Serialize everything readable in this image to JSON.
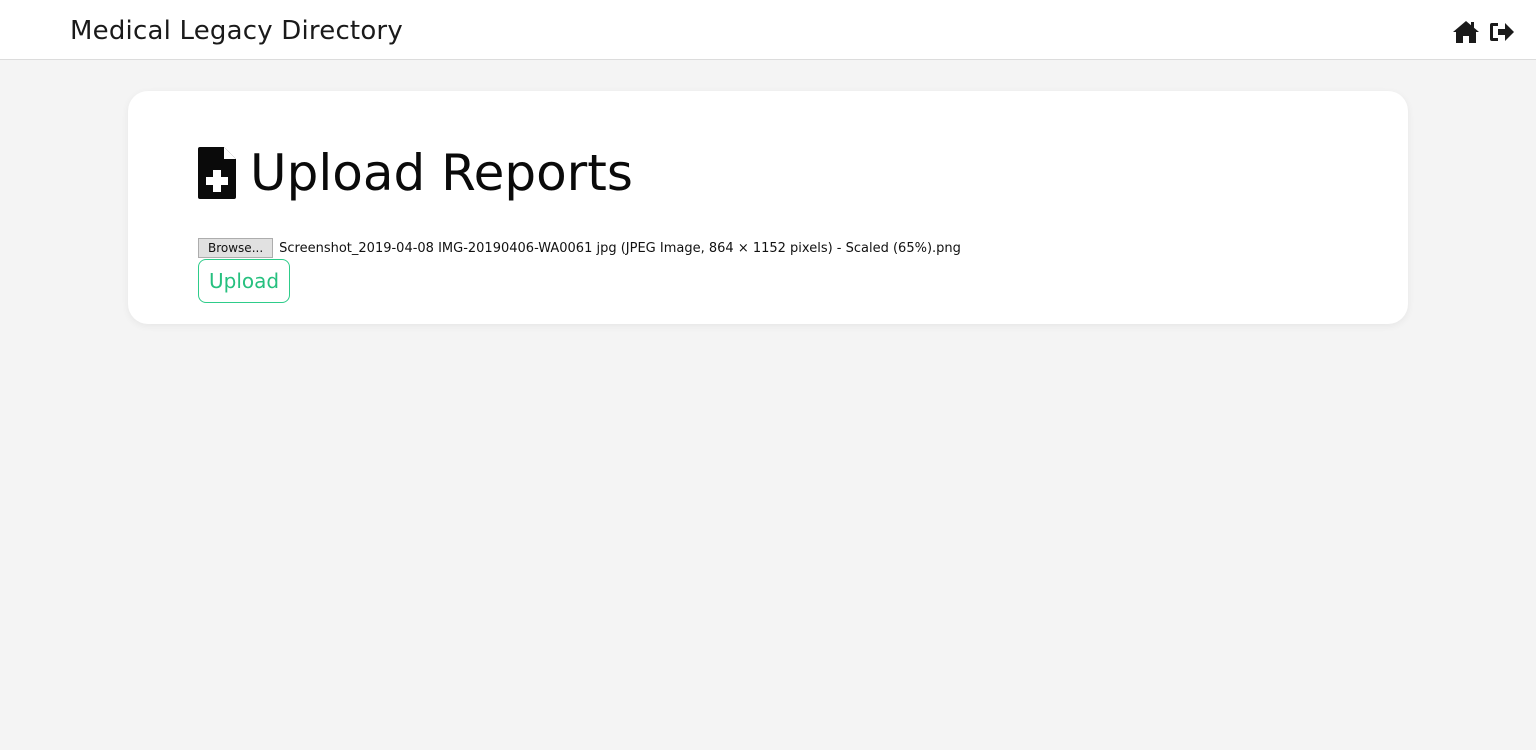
{
  "header": {
    "title": "Medical Legacy Directory",
    "icons": [
      "home-icon",
      "sign-out-icon"
    ]
  },
  "main": {
    "heading": "Upload Reports",
    "heading_icon": "file-medical-icon",
    "file_input": {
      "browse_label": "Browse...",
      "selected_file": "Screenshot_2019-04-08 IMG-20190406-WA0061 jpg (JPEG Image, 864 × 1152 pixels) - Scaled (65%).png"
    },
    "upload_label": "Upload"
  },
  "colors": {
    "background": "#f4f4f4",
    "accent": "#26c07f",
    "text": "#0a0a0a"
  }
}
